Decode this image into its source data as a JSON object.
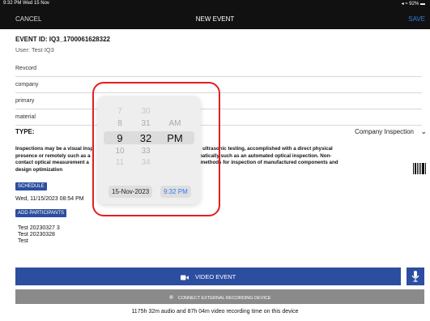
{
  "status_bar": {
    "time": "9:32 PM  Wed 15 Nov",
    "indicators": "◂ ≈ 92% ▬"
  },
  "topbar": {
    "cancel": "CANCEL",
    "title": "NEW EVENT",
    "save": "SAVE"
  },
  "event_id": "EVENT ID: IQ3_1700061628322",
  "user": "User: Test IQ3",
  "fields": [
    {
      "placeholder": "Revcord"
    },
    {
      "placeholder": "company"
    },
    {
      "placeholder": "primary"
    },
    {
      "placeholder": "material"
    }
  ],
  "type": {
    "label": "TYPE:",
    "value": "Company Inspection"
  },
  "description": {
    "line1": "Inspections may be a visual insp",
    "line1b": "gies such as ultrasonic testing, accomplished with a direct physical",
    "line2": "presence or remotely such as a",
    "line2b": "ually or automatically such as an automated optical inspection. Non-",
    "line3": "contact optical measurement a",
    "line3b": "common NDT methods for inspection of manufactured components and",
    "line4": "design optimization"
  },
  "schedule": {
    "button": "SCHEDULE",
    "date": "Wed, 11/15/2023 08:54 PM"
  },
  "participants": {
    "button": "ADD PARTICIPANTS",
    "lines": [
      "Test 20230327 3",
      "Test 20230328",
      "Test"
    ]
  },
  "video_event": "VIDEO EVENT",
  "connect_device": "CONNECT EXTERNAL RECORDING DEVICE",
  "footer": "1175h 32m audio and 87h 04m video recording time on this device",
  "picker": {
    "hours": [
      "7",
      "8",
      "9",
      "10",
      "11"
    ],
    "minutes": [
      "30",
      "31",
      "32",
      "33",
      "34"
    ],
    "ampm": [
      "AM",
      "PM"
    ],
    "date_chip": "15-Nov-2023",
    "time_chip": "9:32 PM"
  },
  "colors": {
    "accent": "#2c4ea0",
    "highlight": "#e02020",
    "time_blue": "#3478f6"
  }
}
